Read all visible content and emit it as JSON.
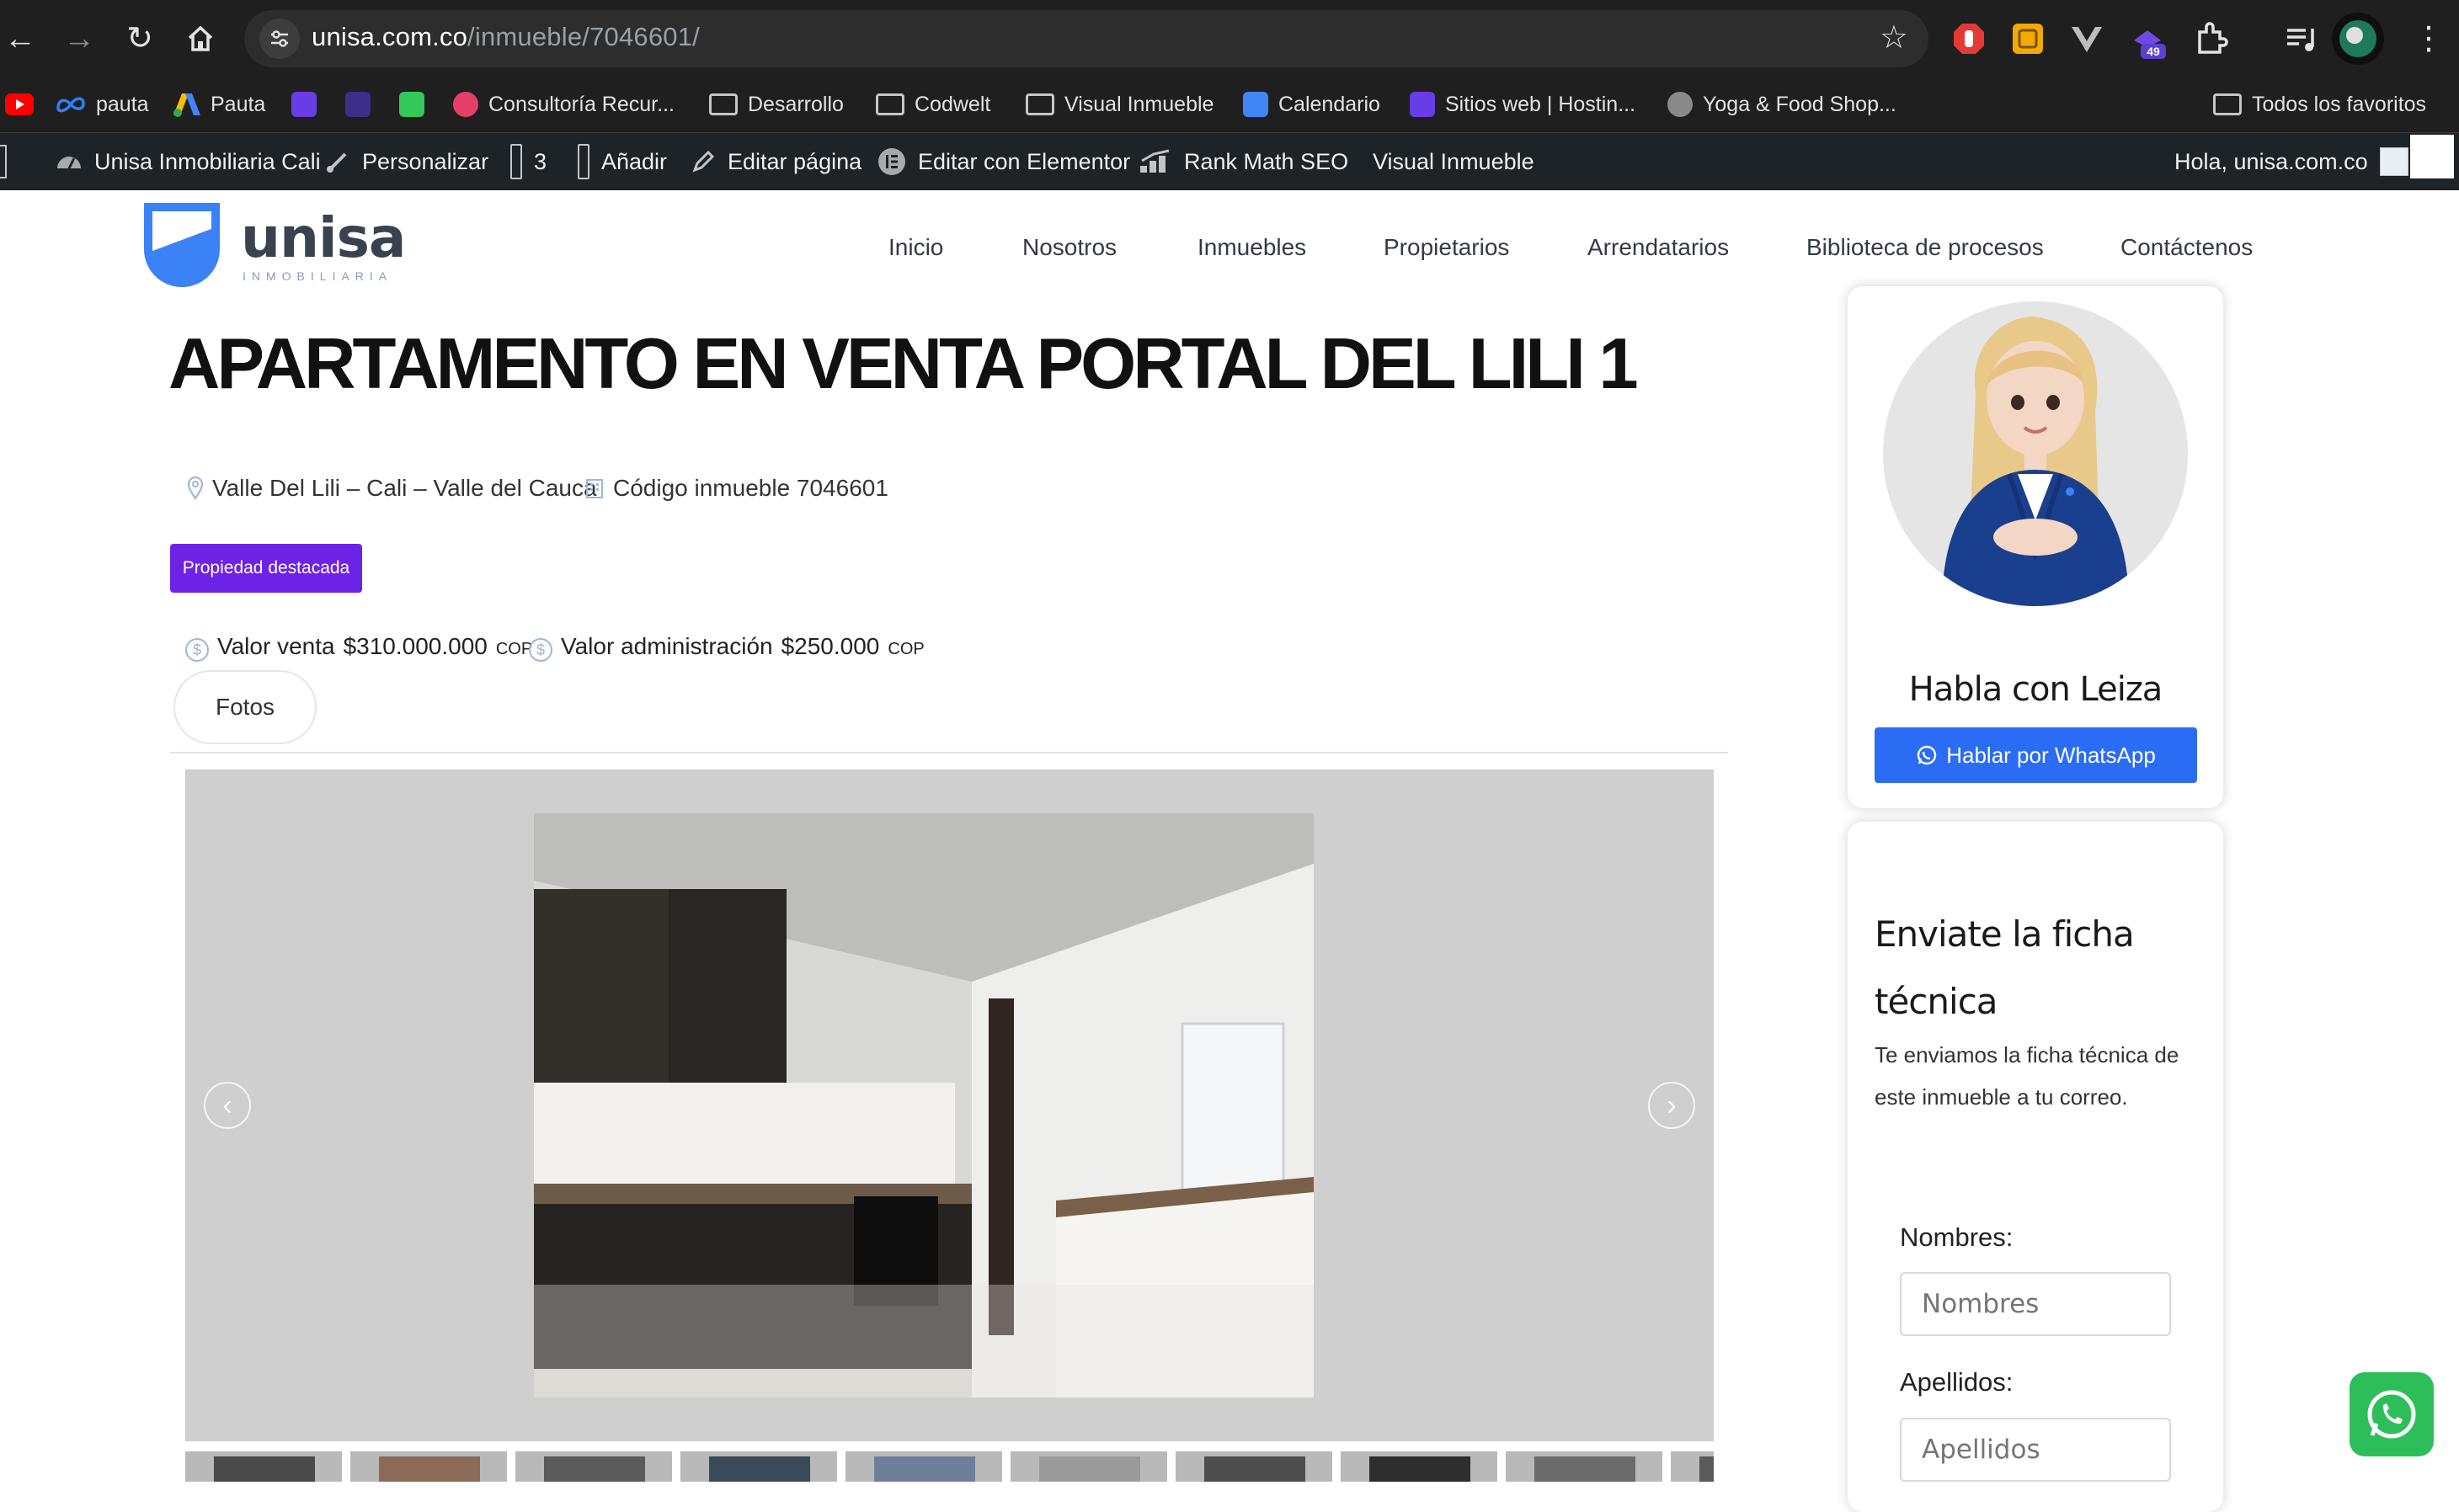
{
  "browser": {
    "url_host": "unisa.com.co",
    "url_path": "/inmueble/7046601/",
    "extension_badge": "49",
    "bookmarks": [
      {
        "label": "pauta",
        "icon": "meta-icon"
      },
      {
        "label": "Pauta",
        "icon": "google-ads-icon"
      },
      {
        "label": "Consultoría Recur...",
        "icon": "y-icon"
      },
      {
        "label": "Desarrollo",
        "icon": "folder-icon"
      },
      {
        "label": "Codwelt",
        "icon": "folder-icon"
      },
      {
        "label": "Visual Inmueble",
        "icon": "folder-icon"
      },
      {
        "label": "Calendario",
        "icon": "calendar-icon"
      },
      {
        "label": "Sitios web | Hostin...",
        "icon": "hostinger-icon"
      },
      {
        "label": "Yoga & Food Shop...",
        "icon": "globe-icon"
      }
    ],
    "all_bookmarks": "Todos los favoritos"
  },
  "admin_bar": {
    "site_name": "Unisa Inmobiliaria Cali",
    "customize": "Personalizar",
    "comments_count": "3",
    "add_new": "Añadir",
    "edit_page": "Editar página",
    "elementor": "Editar con Elementor",
    "rank_math": "Rank Math SEO",
    "visual_inmueble": "Visual Inmueble",
    "greeting": "Hola, unisa.com.co"
  },
  "header": {
    "logo_word": "unisa",
    "logo_sub": "INMOBILIARIA",
    "menu": [
      "Inicio",
      "Nosotros",
      "Inmuebles",
      "Propietarios",
      "Arrendatarios",
      "Biblioteca de procesos",
      "Contáctenos"
    ]
  },
  "property": {
    "title": "APARTAMENTO EN VENTA PORTAL DEL LILI 1",
    "location": "Valle Del Lili – Cali – Valle del Cauca",
    "code": "Código inmueble 7046601",
    "badge": "Propiedad destacada",
    "sale_label": "Valor venta",
    "sale_value": "$310.000.000",
    "admin_label": "Valor administración",
    "admin_value": "$250.000",
    "currency": "COP",
    "photos_button": "Fotos"
  },
  "sidebar": {
    "agent_title": "Habla con Leiza",
    "whatsapp_button": "Hablar por WhatsApp",
    "form_title": "Enviate la ficha técnica",
    "form_desc": "Te enviamos la ficha técnica de este inmueble a tu correo.",
    "fields": [
      {
        "label": "Nombres:",
        "placeholder": "Nombres"
      },
      {
        "label": "Apellidos:",
        "placeholder": "Apellidos"
      }
    ]
  },
  "colors": {
    "brand_blue": "#3b82f6",
    "badge_purple": "#6e22e6",
    "whatsapp_button": "#2a6df4",
    "whatsapp_green": "#2dbe5a"
  }
}
